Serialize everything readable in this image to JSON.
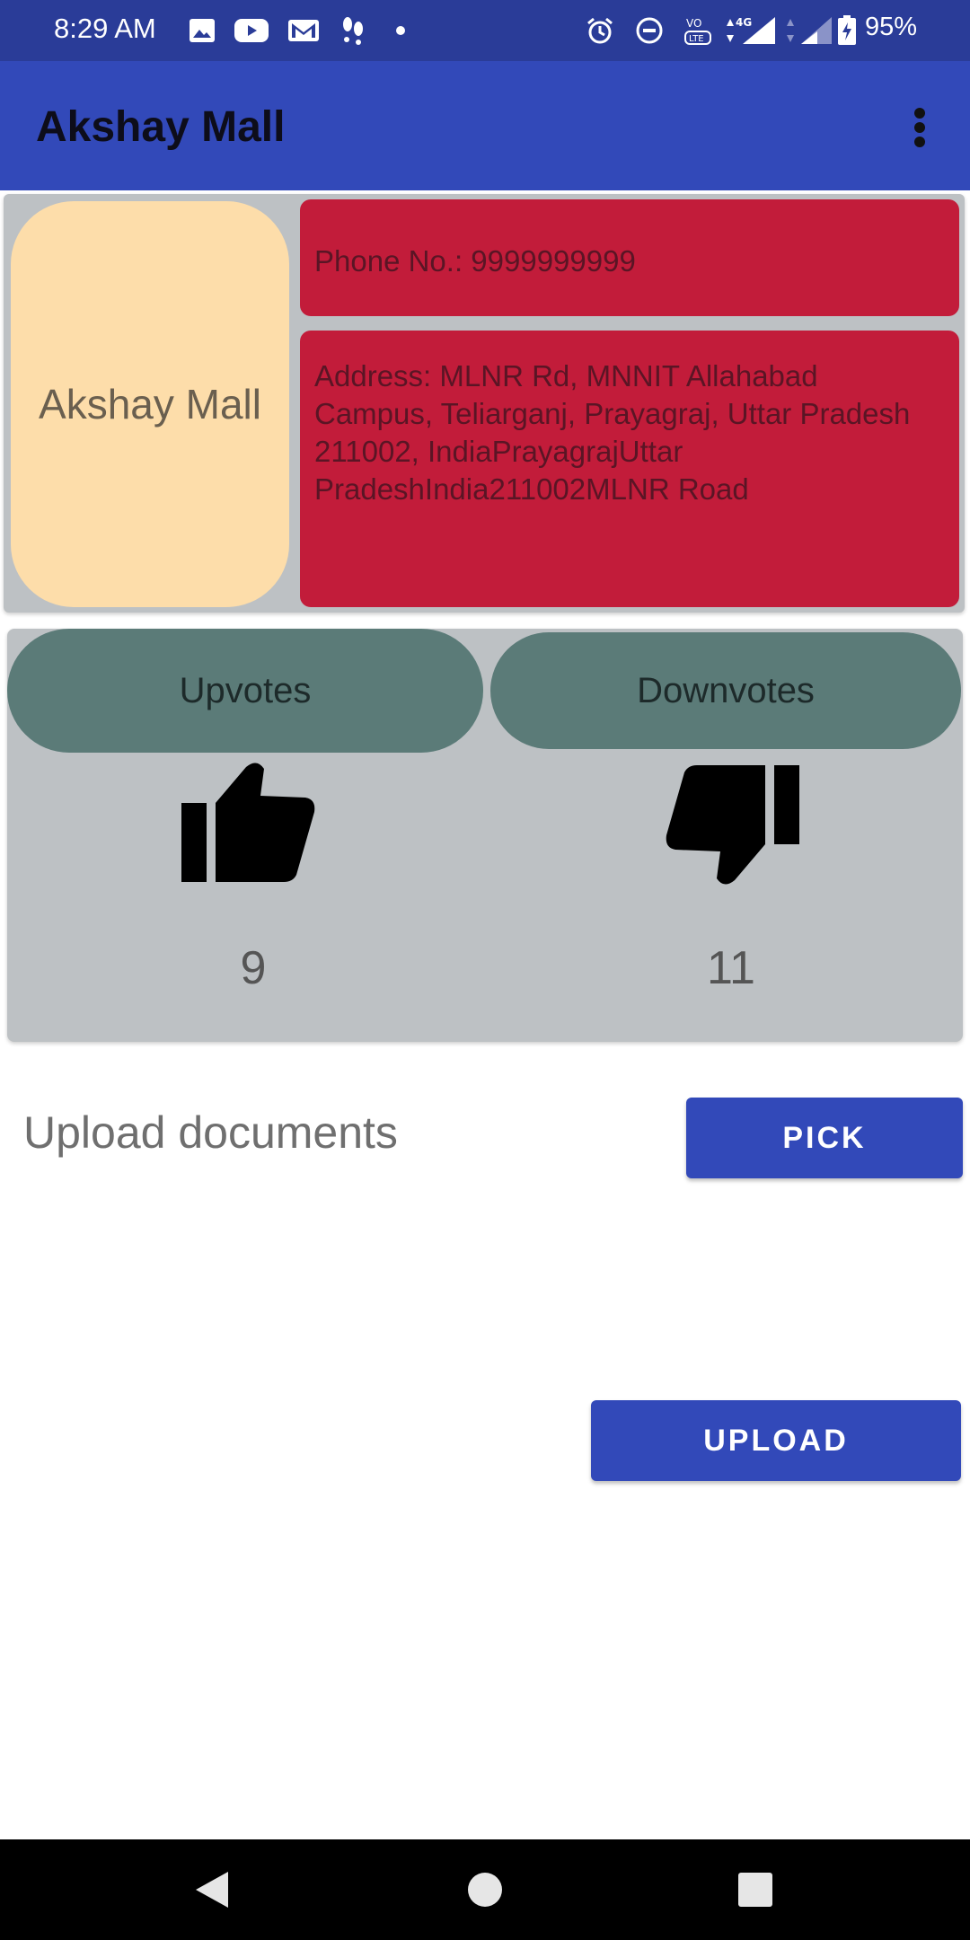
{
  "status_bar": {
    "time": "8:29 AM",
    "battery": "95%",
    "icons_left": [
      "image-icon",
      "youtube-icon",
      "gmail-icon",
      "footsteps-icon",
      "dot-icon"
    ],
    "icons_right": [
      "alarm-icon",
      "dnd-icon",
      "volte-icon",
      "signal-4g-icon",
      "signal-icon",
      "battery-charging-icon"
    ],
    "network_label": "4G"
  },
  "app_bar": {
    "title": "Akshay Mall",
    "overflow_icon": "more-vert-icon"
  },
  "info_card": {
    "mall_name": "Akshay Mall",
    "phone": "Phone No.: 9999999999",
    "address": "Address: MLNR Rd, MNNIT Allahabad Campus, Teliarganj, Prayagraj, Uttar Pradesh 211002, IndiaPrayagrajUttar PradeshIndia211002MLNR Road"
  },
  "votes": {
    "upvote_label": "Upvotes",
    "downvote_label": "Downvotes",
    "upvote_icon": "thumb-up-icon",
    "downvote_icon": "thumb-down-icon",
    "upvote_count": "9",
    "downvote_count": "11"
  },
  "upload": {
    "label": "Upload documents",
    "pick_label": "PICK",
    "upload_label": "UPLOAD"
  },
  "colors": {
    "status_bar": "#2a3c98",
    "app_bar": "#3249b9",
    "card_bg": "#bdc1c4",
    "mall_pill": "#fdddaa",
    "info_red": "#c21c3a",
    "vote_pill": "#5b7b78",
    "button": "#3249b9"
  }
}
